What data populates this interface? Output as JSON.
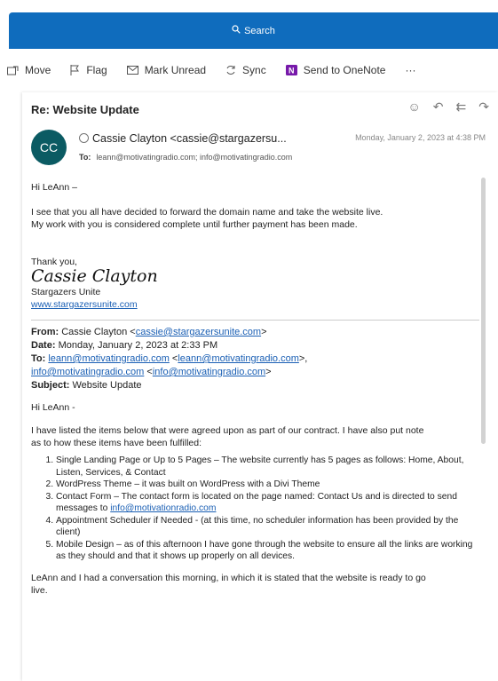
{
  "search": {
    "label": "Search"
  },
  "toolbar": [
    {
      "label": "Move",
      "icon": "move-icon"
    },
    {
      "label": "Flag",
      "icon": "flag-icon"
    },
    {
      "label": "Mark Unread",
      "icon": "mail-icon"
    },
    {
      "label": "Sync",
      "icon": "sync-icon"
    },
    {
      "label": "Send to OneNote",
      "icon": "onenote-icon"
    },
    {
      "label": "···",
      "icon": "more-icon"
    }
  ],
  "message": {
    "subject": "Re: Website Update",
    "avatar_initials": "CC",
    "sender": "Cassie Clayton <cassie@stargazersu...",
    "date": "Monday, January 2, 2023 at 4:38 PM",
    "to_label": "To:",
    "to": "leann@motivatingradio.com;  info@motivatingradio.com",
    "greeting": "Hi LeAnn –",
    "para1a": "I see that you all have decided to forward the domain name and take the website live.",
    "para1b": "My work with you is considered complete until further payment has been made.",
    "thanks": "Thank you,",
    "signature": "Cassie Clayton",
    "company": "Stargazers Unite",
    "website": "www.stargazersunite.com"
  },
  "quoted": {
    "from_label": "From:",
    "from_name": "Cassie Clayton <",
    "from_email": "cassie@stargazersunite.com",
    "from_close": ">",
    "date_label": "Date:",
    "date": "Monday, January 2, 2023 at 2:33 PM",
    "to_label": "To:",
    "to_1": "leann@motivatingradio.com",
    "to_lt": " <",
    "to_1b": "leann@motivatingradio.com",
    "to_gt": ">,",
    "to_2": "info@motivatingradio.com",
    "to_lt2": " <",
    "to_2b": "info@motivatingradio.com",
    "to_gt2": ">",
    "subject_label": "Subject:",
    "subject": "Website Update",
    "greeting": "Hi LeAnn -",
    "intro_a": "I have listed the items below that were agreed upon as part of our contract. I have also put note",
    "intro_b": "as to how these items have been fulfilled:",
    "items": [
      "Single Landing Page or Up to 5 Pages – The website currently has 5 pages as follows: Home, About, Listen, Services, & Contact",
      "WordPress Theme – it was built on WordPress with a Divi Theme",
      "Contact Form – The contact form is located on the page named: Contact Us and is directed to send messages to ",
      "Appointment Scheduler if Needed - (at this time, no scheduler information has been provided by the client)",
      "Mobile Design – as of this afternoon I have gone through the website to ensure all the links are working as they should and that it shows up properly on all devices."
    ],
    "item3_link": "info@motivationradio.com",
    "closing_a": "LeAnn and I had a conversation this morning, in which it is stated that the website is ready to go",
    "closing_b": "live."
  }
}
